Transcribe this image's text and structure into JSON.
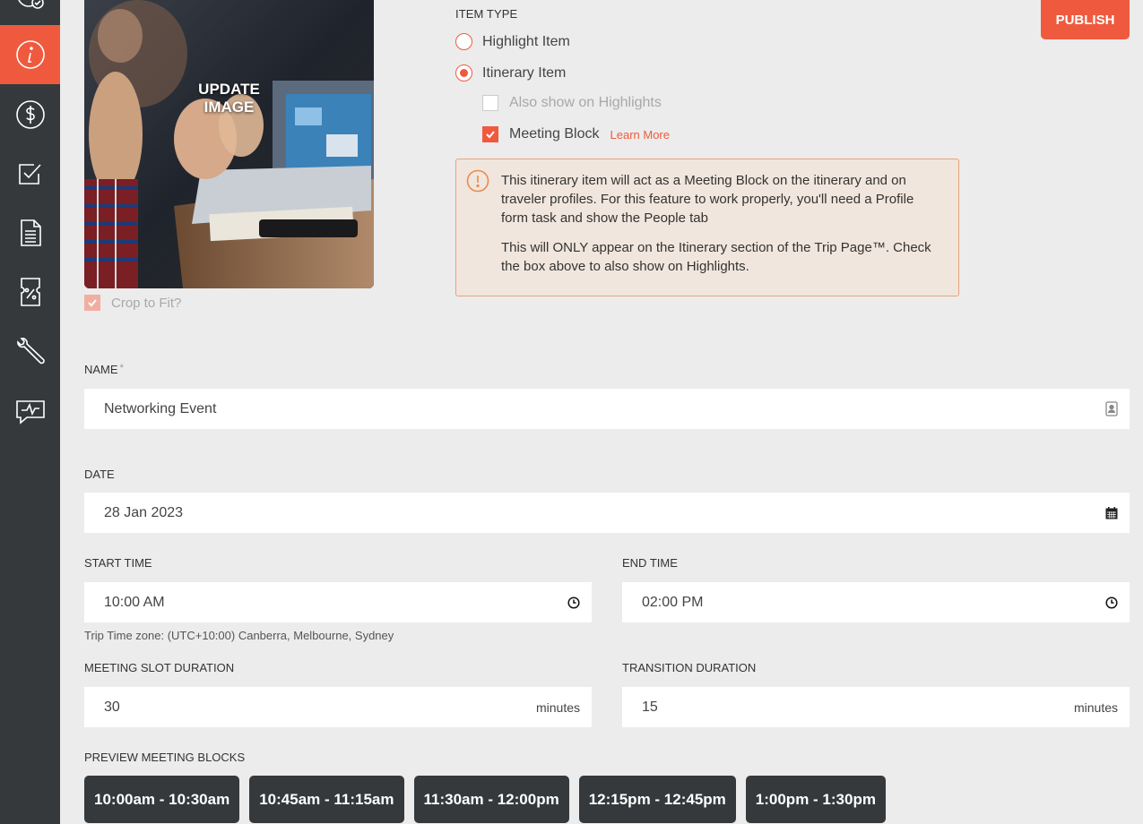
{
  "sidebar": {
    "items": [
      {
        "icon": "globe-check-icon"
      },
      {
        "icon": "info-icon",
        "active": true
      },
      {
        "icon": "dollar-icon"
      },
      {
        "icon": "checkbox-icon"
      },
      {
        "icon": "document-icon"
      },
      {
        "icon": "coupon-icon"
      },
      {
        "icon": "wrench-icon"
      },
      {
        "icon": "chat-pulse-icon"
      }
    ],
    "active_color": "#ef5a3f",
    "background": "#35393b"
  },
  "image": {
    "update_label": "UPDATE IMAGE",
    "crop_label": "Crop to Fit?",
    "crop_checked": true
  },
  "publish_label": "PUBLISH",
  "item_type": {
    "label": "ITEM TYPE",
    "options": [
      {
        "label": "Highlight Item",
        "selected": false
      },
      {
        "label": "Itinerary Item",
        "selected": true
      }
    ],
    "also_show_label": "Also show on Highlights",
    "meeting_block_label": "Meeting Block",
    "learn_more": "Learn More"
  },
  "info_box": {
    "p1": "This itinerary item will act as a Meeting Block on the itinerary and on traveler profiles. For this feature to work properly, you'll need a Profile form task and show the People tab",
    "p2": "This will ONLY appear on the Itinerary section of the Trip Page™. Check the box above to also show on Highlights."
  },
  "form": {
    "name_label": "NAME",
    "name_required": "*",
    "name_value": "Networking Event",
    "date_label": "DATE",
    "date_value": "28 Jan 2023",
    "start_label": "START TIME",
    "start_value": "10:00 AM",
    "end_label": "END TIME",
    "end_value": "02:00 PM",
    "timezone_note": "Trip Time zone: (UTC+10:00) Canberra, Melbourne, Sydney",
    "slot_label": "MEETING SLOT DURATION",
    "slot_value": "30",
    "transition_label": "TRANSITION DURATION",
    "transition_value": "15",
    "minutes_suffix": "minutes"
  },
  "preview": {
    "label": "PREVIEW MEETING BLOCKS",
    "slots": [
      "10:00am - 10:30am",
      "10:45am - 11:15am",
      "11:30am - 12:00pm",
      "12:15pm - 12:45pm",
      "1:00pm - 1:30pm"
    ]
  }
}
